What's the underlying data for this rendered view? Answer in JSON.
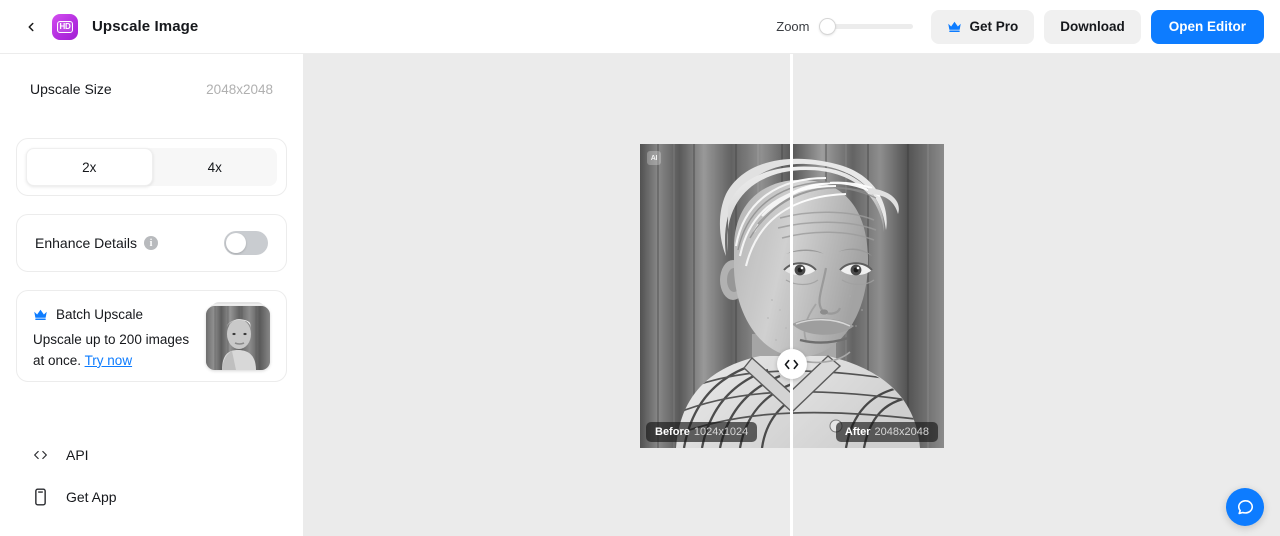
{
  "header": {
    "back_icon": "chevron-left-icon",
    "app_icon": "hd-app-icon",
    "app_icon_text": "HD",
    "title": "Upscale Image",
    "zoom_label": "Zoom",
    "zoom_value": "0",
    "get_pro_label": "Get Pro",
    "get_pro_icon": "crown-icon",
    "download_label": "Download",
    "open_editor_label": "Open Editor"
  },
  "sidebar": {
    "upscale_size_label": "Upscale Size",
    "upscale_size_value": "2048x2048",
    "scale_options": [
      {
        "label": "2x",
        "selected": true
      },
      {
        "label": "4x",
        "selected": false
      }
    ],
    "enhance_details_label": "Enhance Details",
    "enhance_details_info_icon": "info-icon",
    "enhance_details_info_text": "i",
    "enhance_details_on": false,
    "batch": {
      "icon": "crown-icon",
      "title": "Batch Upscale",
      "description_line1": "Upscale up to 200",
      "description_line2": "images at once.",
      "link_label": "Try now",
      "thumbnail_alt": "batch-upscale-thumbnail"
    },
    "nav_items": [
      {
        "label": "API",
        "icon": "code-icon"
      },
      {
        "label": "Get App",
        "icon": "phone-icon"
      }
    ]
  },
  "canvas": {
    "background_color": "#ebebeb",
    "ai_badge_text": "AI",
    "before_label": "Before",
    "before_value": "1024x1024",
    "after_label": "After",
    "after_value": "2048x2048",
    "handle_icon": "compare-slider-handle-icon",
    "divider_color": "#ffffff"
  },
  "support": {
    "chat_icon": "chat-bubble-icon",
    "accent_color": "#0d7cff"
  }
}
